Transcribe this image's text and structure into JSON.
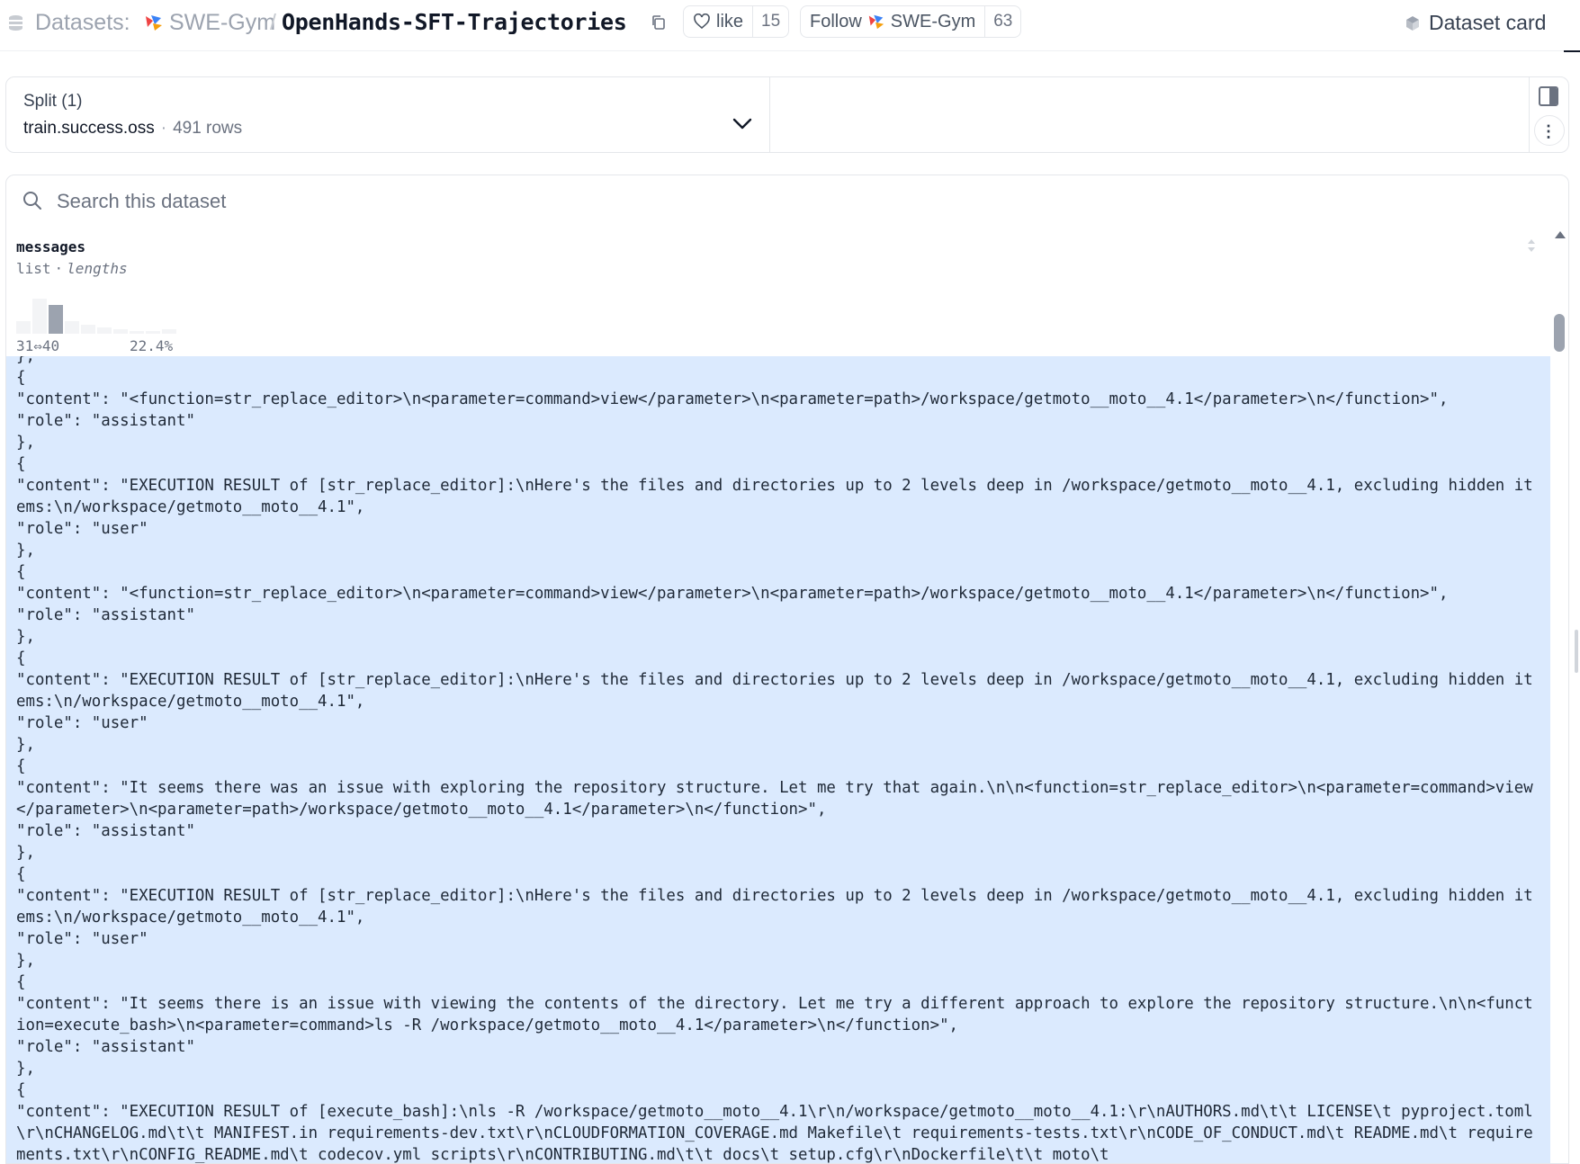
{
  "header": {
    "datasets_label": "Datasets:",
    "org": "SWE-Gym",
    "separator": "/",
    "repo": "OpenHands-SFT-Trajectories",
    "like_label": "like",
    "like_count": "15",
    "follow_label": "Follow",
    "follow_org": "SWE-Gym",
    "follow_count": "63",
    "dataset_card_label": "Dataset card"
  },
  "split": {
    "title": "Split (1)",
    "name": "train.success.oss",
    "separator": "·",
    "rows": "491 rows"
  },
  "search": {
    "placeholder": "Search this dataset"
  },
  "column": {
    "name": "messages",
    "type": "list",
    "separator": "·",
    "stat": "lengths",
    "histogram": {
      "bins": [
        0.35,
        1.0,
        0.82,
        0.35,
        0.26,
        0.18,
        0.12,
        0.08,
        0.08,
        0.14
      ],
      "active_bin": 2,
      "range_label": "31⇔40",
      "percent_label": "22.4%"
    }
  },
  "cell": {
    "lines": [
      "},",
      "{",
      "\"content\": \"<function=str_replace_editor>\\n<parameter=command>view</parameter>\\n<parameter=path>/workspace/getmoto__moto__4.1</parameter>\\n</function>\",",
      "\"role\": \"assistant\"",
      "},",
      "{",
      "\"content\": \"EXECUTION RESULT of [str_replace_editor]:\\nHere's the files and directories up to 2 levels deep in /workspace/getmoto__moto__4.1, excluding hidden items:\\n/workspace/getmoto__moto__4.1\",",
      "\"role\": \"user\"",
      "},",
      "{",
      "\"content\": \"<function=str_replace_editor>\\n<parameter=command>view</parameter>\\n<parameter=path>/workspace/getmoto__moto__4.1</parameter>\\n</function>\",",
      "\"role\": \"assistant\"",
      "},",
      "{",
      "\"content\": \"EXECUTION RESULT of [str_replace_editor]:\\nHere's the files and directories up to 2 levels deep in /workspace/getmoto__moto__4.1, excluding hidden items:\\n/workspace/getmoto__moto__4.1\",",
      "\"role\": \"user\"",
      "},",
      "{",
      "\"content\": \"It seems there was an issue with exploring the repository structure. Let me try that again.\\n\\n<function=str_replace_editor>\\n<parameter=command>view</parameter>\\n<parameter=path>/workspace/getmoto__moto__4.1</parameter>\\n</function>\",",
      "\"role\": \"assistant\"",
      "},",
      "{",
      "\"content\": \"EXECUTION RESULT of [str_replace_editor]:\\nHere's the files and directories up to 2 levels deep in /workspace/getmoto__moto__4.1, excluding hidden items:\\n/workspace/getmoto__moto__4.1\",",
      "\"role\": \"user\"",
      "},",
      "{",
      "\"content\": \"It seems there is an issue with viewing the contents of the directory. Let me try a different approach to explore the repository structure.\\n\\n<function=execute_bash>\\n<parameter=command>ls -R /workspace/getmoto__moto__4.1</parameter>\\n</function>\",",
      "\"role\": \"assistant\"",
      "},",
      "{",
      "\"content\": \"EXECUTION RESULT of [execute_bash]:\\nls -R /workspace/getmoto__moto__4.1\\r\\n/workspace/getmoto__moto__4.1:\\r\\nAUTHORS.md\\t\\t LICENSE\\t pyproject.toml\\r\\nCHANGELOG.md\\t\\t MANIFEST.in requirements-dev.txt\\r\\nCLOUDFORMATION_COVERAGE.md Makefile\\t requirements-tests.txt\\r\\nCODE_OF_CONDUCT.md\\t README.md\\t requirements.txt\\r\\nCONFIG_README.md\\t codecov.yml scripts\\r\\nCONTRIBUTING.md\\t\\t docs\\t setup.cfg\\r\\nDockerfile\\t\\t moto\\t"
    ]
  },
  "colors": {
    "cell_highlight": "#dbeafe",
    "histogram_active": "#9ca3af",
    "histogram_inactive": "#f3f4f6"
  }
}
